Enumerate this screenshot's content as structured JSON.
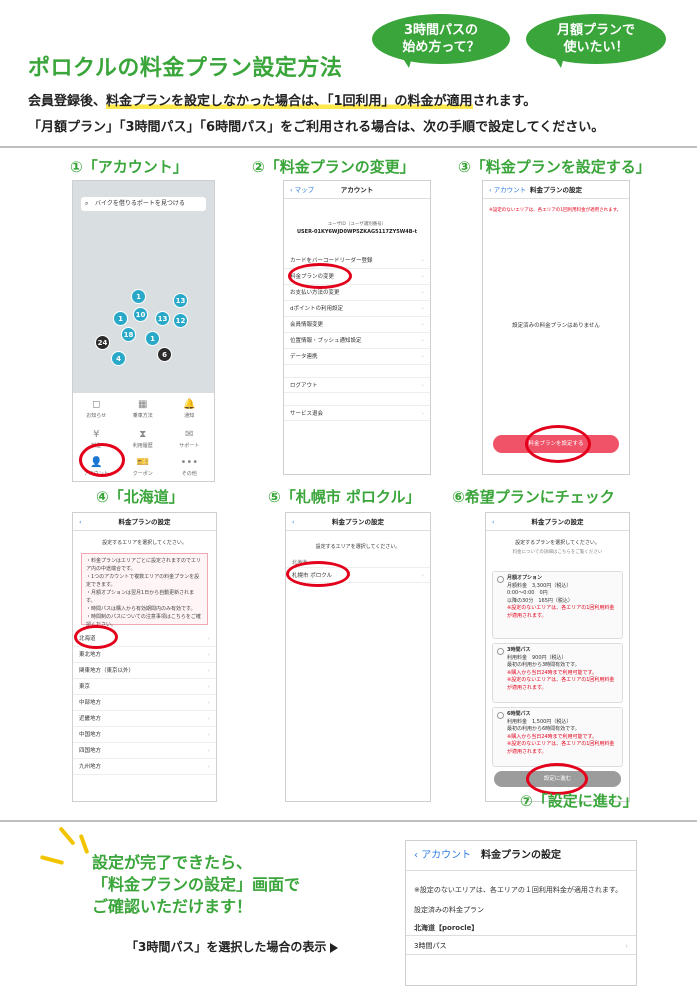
{
  "header": {
    "title": "ポロクルの料金プラン設定方法",
    "bubbles": [
      "3時間パスの\n始め方って？",
      "月額プランで\n使いたい！"
    ],
    "bubble1_l1": "3時間パスの",
    "bubble1_l2": "始め方って？",
    "bubble2_l1": "月額プランで",
    "bubble2_l2": "使いたい！",
    "intro1_a": "会員登録後、",
    "intro1_b": "料金プランを設定しなかった場合は、「1回利用」の料金が適用",
    "intro1_c": "されます。",
    "intro2": "「月額プラン」「3時間パス」「6時間パス」をご利用される場合は、次の手順で設定してください。"
  },
  "steps": {
    "s1": "①「アカウント」",
    "s2": "②「料金プランの変更」",
    "s3": "③「料金プランを設定する」",
    "s4": "④「北海道」",
    "s5": "⑤「札幌市 ポロクル」",
    "s6": "⑥希望プランにチェック",
    "s7": "⑦「設定に進む」"
  },
  "phone1": {
    "search": "バイクを借りるポートを見つける",
    "pins": [
      "1",
      "13",
      "1",
      "10",
      "13",
      "12",
      "18",
      "24",
      "1",
      "6",
      "4"
    ],
    "menu": [
      "お知らせ",
      "乗車方法",
      "通知",
      "料金",
      "利用履歴",
      "サポート",
      "アカウント",
      "クーポン",
      "その他"
    ],
    "menu_icons": [
      "◻",
      "▦",
      "🔔",
      "¥",
      "⧗",
      "✉",
      "👤",
      "🎫",
      "•••"
    ]
  },
  "phone2": {
    "back": "マップ",
    "title": "アカウント",
    "user_label": "ユーザID（ユーザ識別番号）",
    "user_id": "USER-01KY6WJD0WP5ZKAG5117ZY5W4B-t",
    "rows": [
      "カードをバーコードリーダー登録",
      "料金プランの変更",
      "お支払い方法の変更",
      "dポイントの利用設定",
      "会員情報変更",
      "位置情報・プッシュ通知設定",
      "データ連携",
      "ログアウト",
      "サービス退会"
    ]
  },
  "phone3": {
    "back": "アカウント",
    "title": "料金プランの設定",
    "note": "※設定のないエリアは、各エリアの1回利用料金が適用されます。",
    "empty": "設定済みの料金プランはありません",
    "button": "料金プランを設定する"
  },
  "phone4": {
    "title": "料金プランの設定",
    "prompt": "設定するエリアを選択してください。",
    "notes": [
      "・料金プランはエリアごとに設定されますのでエリア内の中途端合です。",
      "・1つのアカウントで複数エリアの料金プランを設定できます。",
      "・月額オプションは翌月1日から自動更新されます。",
      "・時間パスは購入から有効期間内のみ有効です。",
      "・時間制のパスについての注意事項はこちらをご確認ください。"
    ],
    "areas": [
      "北海道",
      "東北地方",
      "関東地方（東京以外）",
      "東京",
      "中部地方",
      "近畿地方",
      "中国地方",
      "四国地方",
      "九州地方"
    ]
  },
  "phone5": {
    "title": "料金プランの設定",
    "prompt": "設定するエリアを選択してください。",
    "region": "北海道",
    "item": "札幌市 ポロクル"
  },
  "phone6": {
    "title": "料金プランの設定",
    "prompt": "設定するプランを選択してください。",
    "subnote": "料金についての詳細はこちらをご覧ください",
    "plans": [
      {
        "name": "月額オプション",
        "l1": "月額料金　3,300円（税込）",
        "l2": "0:00〜0:00　0円",
        "l3": "以降の30分　165円（税込）",
        "n1": "※設定のないエリアは、各エリアの1回利用料金が適用されます。"
      },
      {
        "name": "3時間パス",
        "l1": "利用料金　900円（税込）",
        "l2": "最初の利用から3時間有効です。",
        "l3": "",
        "n1": "※購入から当日24時まで利用可能です。",
        "n2": "※設定のないエリアは、各エリアの1回利用料金が適用されます。"
      },
      {
        "name": "6時間パス",
        "l1": "利用料金　1,500円（税込）",
        "l2": "最初の利用から6時間有効です。",
        "l3": "",
        "n1": "※購入から当日24時まで利用可能です。",
        "n2": "※設定のないエリアは、各エリアの1回利用料金が適用されます。"
      }
    ],
    "button": "設定に進む"
  },
  "footer": {
    "line1": "設定が完了できたら、",
    "line2": "「料金プランの設定」画面で",
    "line3": "ご確認いただけます！",
    "result_label": "「3時間パス」を選択した場合の表示"
  },
  "result": {
    "back": "アカウント",
    "title": "料金プランの設定",
    "note": "※設定のないエリアは、各エリアの１回利用料金が適用されます。",
    "section": "設定済みの料金プラン",
    "area": "北海道【porocle】",
    "plan": "3時間パス"
  },
  "colors": {
    "accent": "#3aa53a",
    "highlight": "#ffe94d",
    "ring": "#e3001b",
    "button": "#f05267"
  }
}
